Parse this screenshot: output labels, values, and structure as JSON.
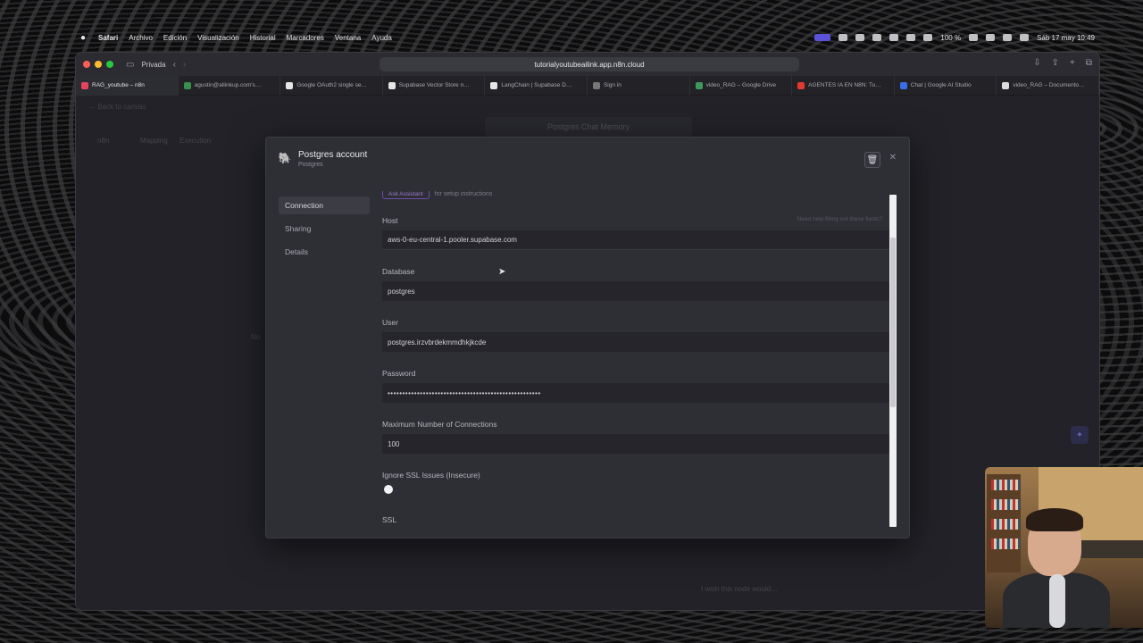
{
  "menubar": {
    "app": "Safari",
    "items": [
      "Archivo",
      "Edición",
      "Visualización",
      "Historial",
      "Marcadores",
      "Ventana",
      "Ayuda"
    ],
    "battery": "100 %",
    "datetime": "Sáb 17 may 10:49"
  },
  "browser": {
    "private_label": "Privada",
    "url": "tutorialyoutubeailink.app.n8n.cloud",
    "tabs": [
      {
        "label": "RAG_youtube – n8n",
        "color": "#e2445c"
      },
      {
        "label": "agustin@allinkup.com's…",
        "color": "#3a8f4a"
      },
      {
        "label": "Google OAuth2 single se…",
        "color": "#e6e6e6"
      },
      {
        "label": "Supabase Vector Store n…",
        "color": "#e6e6e6"
      },
      {
        "label": "LangChain | Supabase D…",
        "color": "#e6e6e6"
      },
      {
        "label": "Sign in",
        "color": "#777"
      },
      {
        "label": "video_RAG – Google Drive",
        "color": "#3c9a5c"
      },
      {
        "label": "AGENTES IA EN N8N: Tu…",
        "color": "#e23a2e"
      },
      {
        "label": "Chat | Google AI Studio",
        "color": "#3a6ee8"
      },
      {
        "label": "video_RAG – Documento…",
        "color": "#dcdcdc"
      }
    ]
  },
  "page": {
    "back_link": "← Back to canvas",
    "node_title": "Postgres Chat Memory",
    "left_tabs": [
      "n8n",
      "Mapping",
      "Execution"
    ],
    "no_text": "No",
    "bottom_hint": "I wish this node would…"
  },
  "modal": {
    "title": "Postgres account",
    "subtitle": "Postgres",
    "nav": [
      "Connection",
      "Sharing",
      "Details"
    ],
    "notice_button": "Ask Assistant",
    "notice_text": "for setup instructions",
    "host_hint": "Need help filling out these fields?",
    "fields": [
      {
        "label": "Host",
        "value": "aws-0-eu-central-1.pooler.supabase.com"
      },
      {
        "label": "Database",
        "value": "postgres"
      },
      {
        "label": "User",
        "value": "postgres.irzvbrdekmmdhkjkcde"
      },
      {
        "label": "Password",
        "value": "••••••••••••••••••••••••••••••••••••••••••••••••••••"
      },
      {
        "label": "Maximum Number of Connections",
        "value": "100"
      }
    ],
    "ssl_ignore_label": "Ignore SSL Issues (Insecure)",
    "ssl_label": "SSL"
  }
}
